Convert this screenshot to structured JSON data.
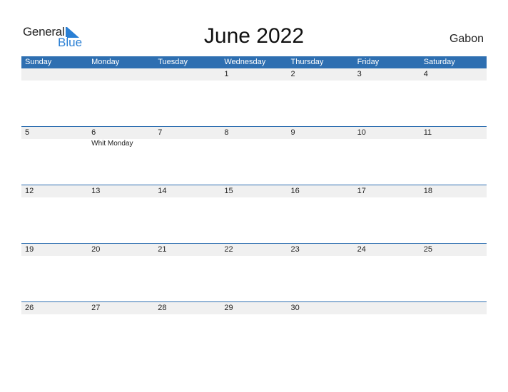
{
  "logo": {
    "line1": "General",
    "line2": "Blue"
  },
  "title": "June 2022",
  "country": "Gabon",
  "colors": {
    "header_bg": "#2e6fb1",
    "strip_bg": "#f0f0f0",
    "logo_blue": "#2a7fd4"
  },
  "weekdays": [
    "Sunday",
    "Monday",
    "Tuesday",
    "Wednesday",
    "Thursday",
    "Friday",
    "Saturday"
  ],
  "weeks": [
    {
      "days": [
        "",
        "",
        "",
        "1",
        "2",
        "3",
        "4"
      ],
      "events": [
        "",
        "",
        "",
        "",
        "",
        "",
        ""
      ]
    },
    {
      "days": [
        "5",
        "6",
        "7",
        "8",
        "9",
        "10",
        "11"
      ],
      "events": [
        "",
        "Whit Monday",
        "",
        "",
        "",
        "",
        ""
      ]
    },
    {
      "days": [
        "12",
        "13",
        "14",
        "15",
        "16",
        "17",
        "18"
      ],
      "events": [
        "",
        "",
        "",
        "",
        "",
        "",
        ""
      ]
    },
    {
      "days": [
        "19",
        "20",
        "21",
        "22",
        "23",
        "24",
        "25"
      ],
      "events": [
        "",
        "",
        "",
        "",
        "",
        "",
        ""
      ]
    },
    {
      "days": [
        "26",
        "27",
        "28",
        "29",
        "30",
        "",
        ""
      ],
      "events": [
        "",
        "",
        "",
        "",
        "",
        "",
        ""
      ]
    }
  ]
}
